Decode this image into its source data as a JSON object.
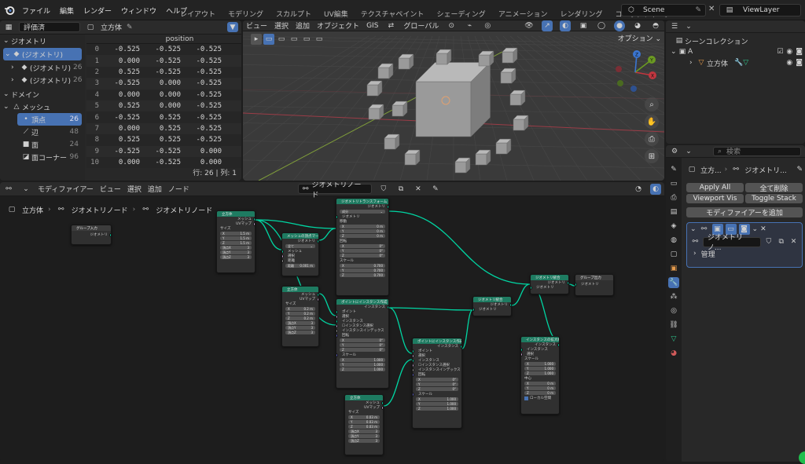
{
  "menu": {
    "file": "ファイル",
    "edit": "編集",
    "render": "レンダー",
    "window": "ウィンドウ",
    "help": "ヘルプ"
  },
  "workspaces": [
    "レイアウト",
    "モデリング",
    "スカルプト",
    "UV編集",
    "テクスチャペイント",
    "シェーディング",
    "アニメーション",
    "レンダリング",
    "コンポジティング"
  ],
  "scene": "Scene",
  "view_layer": "ViewLayer",
  "spreadsheet": {
    "mode": "評価済",
    "object": "立方体",
    "col": "position",
    "tree": {
      "geometry": "ジオメトリ",
      "geo_selected": "(ジオメトリ)",
      "sub1": "(ジオメトリ)",
      "sub1_count": "26",
      "sub2": "(ジオメトリ)",
      "sub2_count": "26",
      "domain": "ドメイン",
      "mesh": "メッシュ",
      "vertex": "頂点",
      "vertex_count": "26",
      "edge": "辺",
      "edge_count": "48",
      "face": "面",
      "face_count": "24",
      "corner": "面コーナー",
      "corner_count": "96"
    },
    "rows": [
      [
        "0",
        "-0.525",
        "-0.525",
        "-0.525"
      ],
      [
        "1",
        "0.000",
        "-0.525",
        "-0.525"
      ],
      [
        "2",
        "0.525",
        "-0.525",
        "-0.525"
      ],
      [
        "3",
        "-0.525",
        "0.000",
        "-0.525"
      ],
      [
        "4",
        "0.000",
        "0.000",
        "-0.525"
      ],
      [
        "5",
        "0.525",
        "0.000",
        "-0.525"
      ],
      [
        "6",
        "-0.525",
        "0.525",
        "-0.525"
      ],
      [
        "7",
        "0.000",
        "0.525",
        "-0.525"
      ],
      [
        "8",
        "0.525",
        "0.525",
        "-0.525"
      ],
      [
        "9",
        "-0.525",
        "-0.525",
        "0.000"
      ],
      [
        "10",
        "0.000",
        "-0.525",
        "0.000"
      ]
    ],
    "footer": "行: 26 | 列: 1"
  },
  "viewport": {
    "view": "ビュー",
    "select": "選択",
    "add": "追加",
    "object": "オブジェクト",
    "gis": "GIS",
    "orient": "グローバル",
    "options": "オプション",
    "axis_x": "X",
    "axis_y": "Y",
    "axis_z": "Z"
  },
  "node_editor": {
    "mode": "モディファイアー",
    "view": "ビュー",
    "select": "選択",
    "add": "追加",
    "node": "ノード",
    "tree_name": "ジオメトリノード",
    "breadcrumb": [
      "立方体",
      "ジオメトリノード",
      "ジオメトリノード"
    ]
  },
  "nodes": {
    "group_in": {
      "title": "グループ入力",
      "out": "ジオメトリ"
    },
    "cube1": {
      "title": "立方体",
      "o1": "メッシュ",
      "o2": "UVマップ",
      "size": "サイズ",
      "x": "X",
      "xv": "1.5 m",
      "y": "Y",
      "yv": "1.5 m",
      "z": "Z",
      "zv": "1.5 m",
      "vx": "頂点X",
      "vxv": "3",
      "vy": "頂点Y",
      "vyv": "3",
      "vz": "頂点Z",
      "vzv": "3"
    },
    "merge": {
      "title": "メッシュの頂点マージ",
      "out": "ジオメトリ",
      "mode": "全て",
      "i1": "メッシュ",
      "i2": "選択",
      "i3": "距離",
      "dist": "距離",
      "distv": "0.001 m"
    },
    "transform": {
      "title": "ジオメトリトランスフォーム",
      "out": "ジオメトリ",
      "mode": "成分",
      "i1": "ジオメトリ",
      "t": "移動",
      "x": "X",
      "xv": "0 m",
      "y": "Y",
      "yv": "0 m",
      "z": "Z",
      "zv": "0 m",
      "r": "回転",
      "rx": "0°",
      "ry": "0°",
      "rz": "0°",
      "s": "スケール",
      "sx": "0.700",
      "sy": "0.700",
      "sz": "0.700"
    },
    "cube2": {
      "title": "立方体",
      "o1": "メッシュ",
      "o2": "UVマップ",
      "size": "サイズ",
      "xv": "0.2 m",
      "yv": "0.2 m",
      "zv": "0.2 m",
      "vx": "頂点X",
      "vxv": "3",
      "vy": "頂点Y",
      "vyv": "3",
      "vz": "頂点Z",
      "vzv": "3"
    },
    "inst1": {
      "title": "ポイントにインスタンス作成",
      "out": "インスタンス",
      "i1": "ポイント",
      "i2": "選択",
      "i3": "インスタンス",
      "i4": "インスタンス選択",
      "i5": "インスタンスインデックス",
      "r": "回転",
      "rx": "0°",
      "ry": "0°",
      "rz": "0°",
      "s": "スケール",
      "sx": "1.000",
      "sy": "1.000",
      "sz": "1.000"
    },
    "join": {
      "title": "ジオメトリ統合",
      "out": "ジオメトリ",
      "in": "ジオメトリ"
    },
    "realize": {
      "title": "ジオメトリ統合",
      "out": "ジオメトリ",
      "in": "ジオメトリ"
    },
    "group_out": {
      "title": "グループ出力",
      "in": "ジオメトリ"
    },
    "inst2": {
      "title": "ポイントにインスタンス作成",
      "out": "インスタンス",
      "i1": "ポイント",
      "i2": "選択",
      "i3": "インスタンス",
      "i4": "インスタンス選択",
      "i5": "インスタンスインデックス",
      "r": "回転",
      "rx": "0°",
      "ry": "0°",
      "rz": "0°",
      "s": "スケール",
      "sx": "1.000",
      "sy": "1.000",
      "sz": "1.000"
    },
    "cube3": {
      "title": "立方体",
      "o1": "メッシュ",
      "o2": "UVマップ",
      "size": "サイズ",
      "xv": "0.03 m",
      "yv": "0.03 m",
      "zv": "0.03 m",
      "vx": "頂点X",
      "vxv": "3",
      "vy": "頂点Y",
      "vyv": "3",
      "vz": "頂点Z",
      "vzv": "3"
    },
    "scale": {
      "title": "インスタンスの拡大縮小",
      "out": "インスタンス",
      "i1": "インスタンス",
      "i2": "選択",
      "s": "スケール",
      "sx": "1.000",
      "sy": "1.000",
      "sz": "1.000",
      "c": "中心",
      "cx": "0 m",
      "cy": "0 m",
      "cz": "0 m",
      "local": "ローカル空間"
    }
  },
  "outliner": {
    "scene_collection": "シーンコレクション",
    "collection": "A",
    "object": "立方体"
  },
  "properties": {
    "search_placeholder": "検索",
    "object": "立方...",
    "modifier_name": "ジオメトリ...",
    "apply_all": "Apply All",
    "delete_all": "全て削除",
    "viewport_vis": "Viewport Vis",
    "toggle_stack": "Toggle Stack",
    "add_modifier": "モディファイアーを追加",
    "geo_nodes": "ジオメトリノ...",
    "manage": "管理"
  },
  "colors": {
    "accent": "#4772b3",
    "node_header": "#1e7b61",
    "wire": "#00d6a3"
  }
}
